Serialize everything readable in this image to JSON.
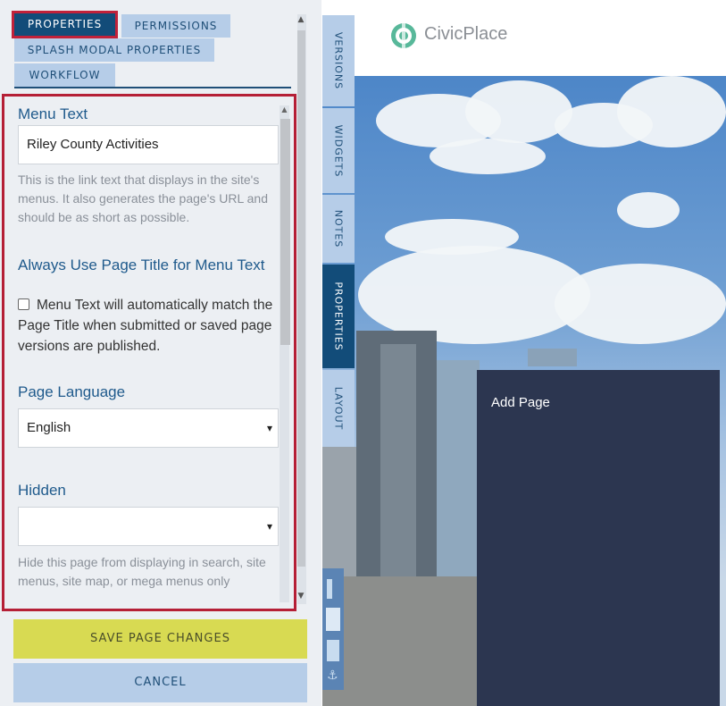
{
  "left_panel": {
    "tabs": [
      {
        "label": "PROPERTIES",
        "active": true
      },
      {
        "label": "PERMISSIONS",
        "active": false
      },
      {
        "label": "SPLASH MODAL PROPERTIES",
        "active": false
      },
      {
        "label": "WORKFLOW",
        "active": false
      }
    ],
    "fields": {
      "menu_text": {
        "label": "Menu Text",
        "value": "Riley County Activities",
        "help": "This is the link text that displays in the site's menus. It also generates the page's URL and should be as short as possible."
      },
      "always_use_title": {
        "label": "Always Use Page Title for Menu Text",
        "checkbox_text": "Menu Text will automatically match the Page Title when submitted or saved page versions are published.",
        "checked": false
      },
      "page_language": {
        "label": "Page Language",
        "selected": "English"
      },
      "hidden": {
        "label": "Hidden",
        "selected": "",
        "help": "Hide this page from displaying in search, site menus, site map, or mega menus only"
      }
    },
    "buttons": {
      "save": "SAVE PAGE CHANGES",
      "cancel": "CANCEL"
    }
  },
  "vertical_tabs": [
    {
      "label": "VERSIONS",
      "active": false
    },
    {
      "label": "WIDGETS",
      "active": false
    },
    {
      "label": "NOTES",
      "active": false
    },
    {
      "label": "PROPERTIES",
      "active": true
    },
    {
      "label": "LAYOUT",
      "active": false
    }
  ],
  "preview": {
    "logo_text": "CivicPlace",
    "card_text": "Add Page"
  },
  "colors": {
    "accent": "#124c79",
    "tab": "#b6cde8",
    "highlight_outline": "#c0213a",
    "save": "#d8da52",
    "card": "#2c3650"
  }
}
